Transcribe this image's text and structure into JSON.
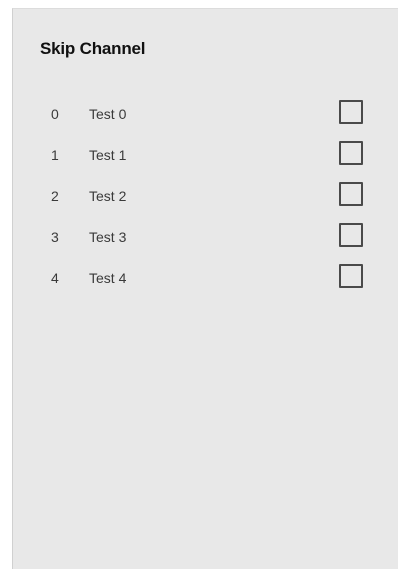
{
  "title": "Skip Channel",
  "channels": [
    {
      "index": "0",
      "name": "Test 0",
      "skipped": false
    },
    {
      "index": "1",
      "name": "Test 1",
      "skipped": false
    },
    {
      "index": "2",
      "name": "Test 2",
      "skipped": false
    },
    {
      "index": "3",
      "name": "Test 3",
      "skipped": false
    },
    {
      "index": "4",
      "name": "Test 4",
      "skipped": false
    }
  ]
}
